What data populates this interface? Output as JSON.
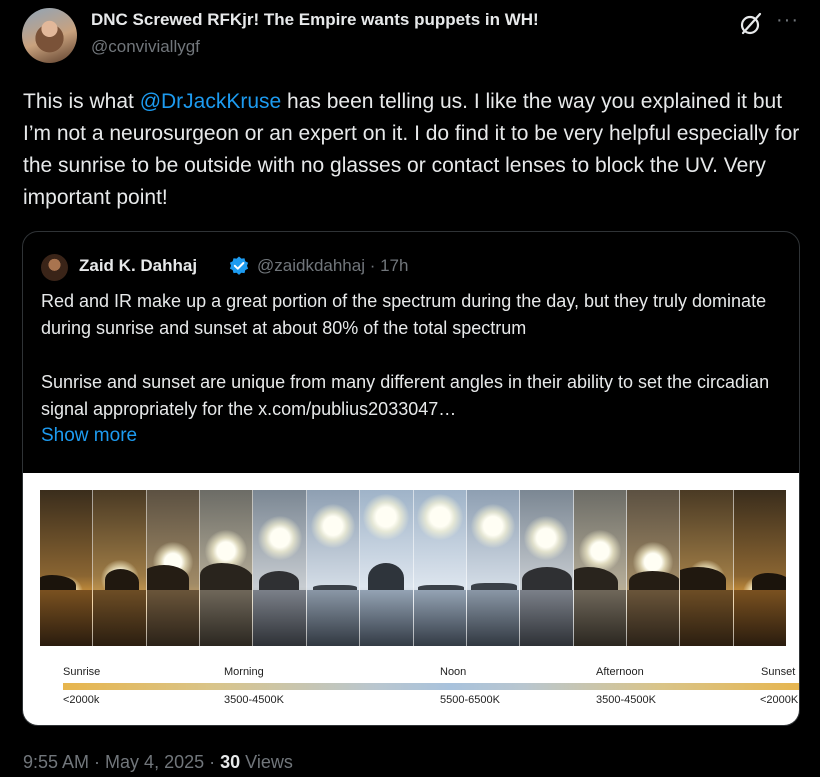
{
  "author": {
    "name": "DNC Screwed RFKjr! The Empire wants puppets in WH!",
    "handle": "@conviviallygf"
  },
  "icons": {
    "grok": "grok-icon",
    "more": "more-icon",
    "verified": "verified-badge-icon"
  },
  "tweet": {
    "text_before": "This is what ",
    "mention": "@DrJackKruse",
    "text_after": " has been telling us.  I like the way you explained it but I’m not a neurosurgeon or an expert on it.  I do find it to be very helpful especially for the sunrise to be outside with no glasses or contact lenses to block the UV.  Very important point!"
  },
  "quote": {
    "name": "Zaid K. Dahhaj",
    "handle": "@zaidkdahhaj · 17h",
    "paragraph1": "Red and IR make up a great portion of the spectrum during the day, but they truly dominate during sunrise and sunset at about 80% of the total spectrum",
    "paragraph2": "Sunrise and sunset are unique from many different angles in their ability to set the circadian signal appropriately for the  x.com/publius2033047…",
    "show_more": "Show more",
    "figure": {
      "time_labels": [
        "Sunrise",
        "Morning",
        "Noon",
        "Afternoon",
        "Sunset"
      ],
      "temp_labels": [
        "<2000k",
        "3500-4500K",
        "5500-6500K",
        "3500-4500K",
        "<2000K"
      ]
    }
  },
  "meta": {
    "time": "9:55 AM",
    "sep1": " · ",
    "date": "May 4, 2025",
    "sep2": " · ",
    "views_count": "30",
    "views_label": " Views"
  },
  "colors": {
    "accent": "#1d9bf0",
    "muted": "#71767b",
    "text": "#e7e9ea",
    "background": "#000000"
  }
}
